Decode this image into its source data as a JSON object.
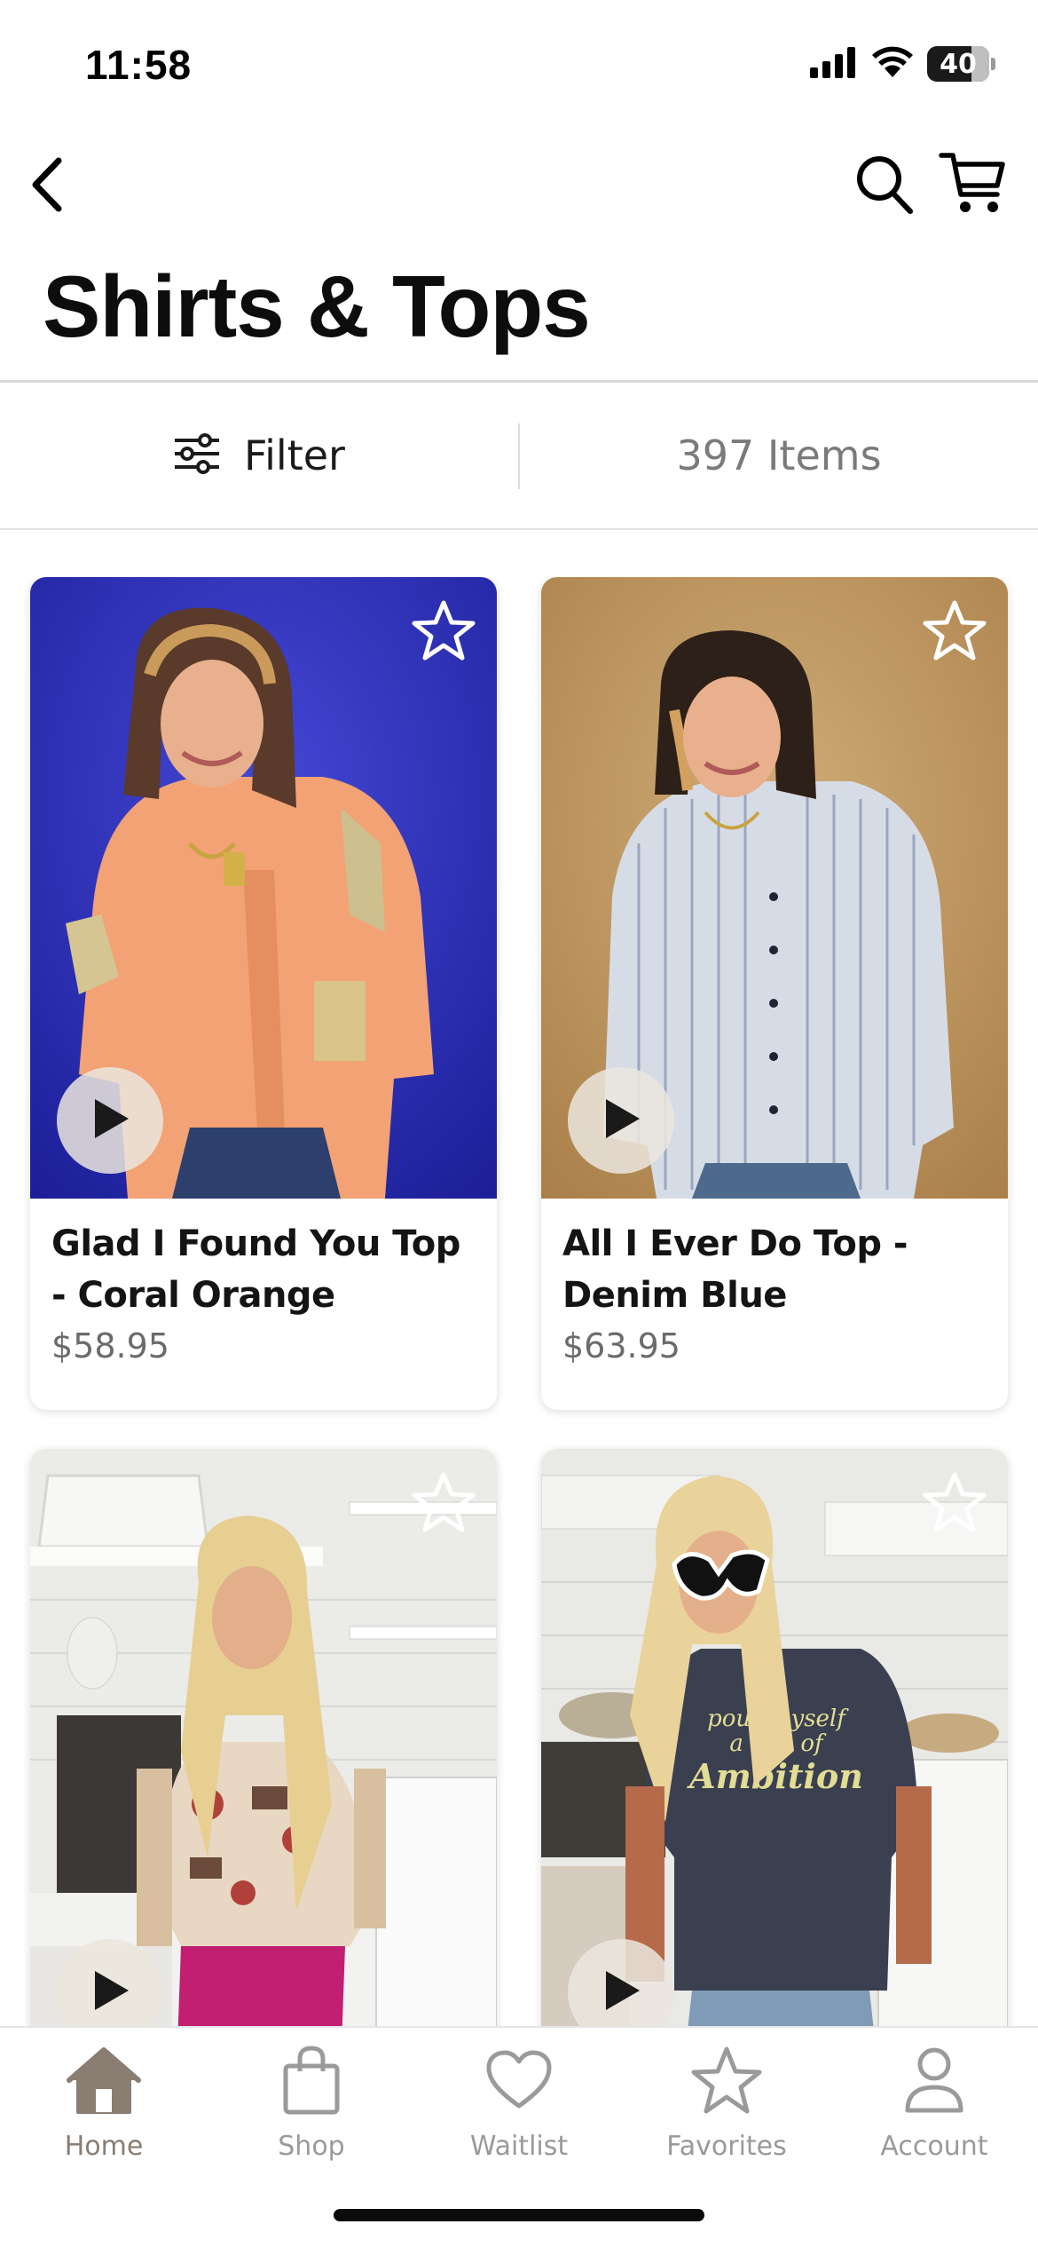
{
  "status_bar": {
    "time": "11:58",
    "battery_level": "40"
  },
  "nav": {
    "back_icon": "chevron-left-icon",
    "search_icon": "search-icon",
    "cart_icon": "cart-icon"
  },
  "page": {
    "title": "Shirts & Tops"
  },
  "toolbar": {
    "filter_label": "Filter",
    "items_count": "397 Items"
  },
  "products": [
    {
      "name": "Glad I Found You Top - Coral Orange",
      "price": "$58.95"
    },
    {
      "name": "All I Ever Do Top - Denim Blue",
      "price": "$63.95"
    },
    {
      "name": "",
      "price": ""
    },
    {
      "name": "",
      "price": ""
    }
  ],
  "product_images": {
    "tshirt_text": [
      "pour myself",
      "a cup of",
      "Ambition"
    ]
  },
  "tabs": [
    {
      "label": "Home",
      "icon": "home-icon",
      "active": true
    },
    {
      "label": "Shop",
      "icon": "shopping-bag-icon",
      "active": false
    },
    {
      "label": "Waitlist",
      "icon": "heart-icon",
      "active": false
    },
    {
      "label": "Favorites",
      "icon": "star-icon",
      "active": false
    },
    {
      "label": "Account",
      "icon": "person-icon",
      "active": false
    }
  ],
  "colors": {
    "accent_brown": "#8a7d72",
    "inactive_gray": "#9a9a9a",
    "card1_backdrop": "#2a2ec0",
    "card2_backdrop": "#c9a26a"
  }
}
